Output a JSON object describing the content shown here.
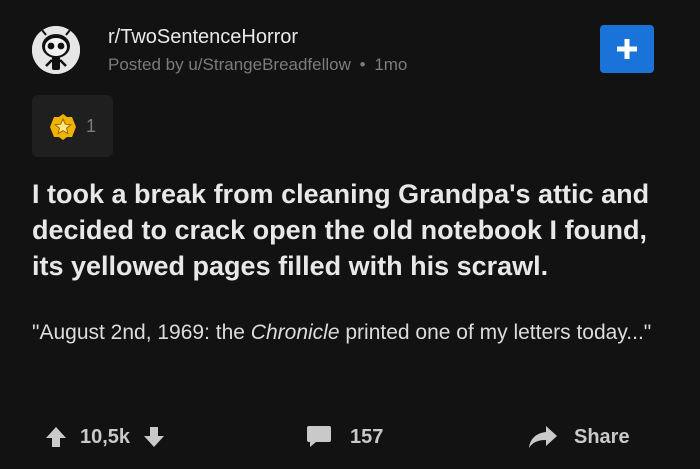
{
  "header": {
    "subreddit": "r/TwoSentenceHorror",
    "posted_by_prefix": "Posted by",
    "username": "u/StrangeBreadfellow",
    "separator": "•",
    "age": "1mo",
    "join_icon": "plus-icon"
  },
  "awards": {
    "icon": "star-award-icon",
    "count": "1"
  },
  "post": {
    "title": "I took a break from cleaning Grandpa's attic and decided to crack open the old notebook I found, its yellowed pages filled with his scrawl.",
    "body_before": "\"August 2nd, 1969: the ",
    "body_italic": "Chronicle",
    "body_after": " printed one of my letters today...\""
  },
  "footer": {
    "score": "10,5k",
    "comments": "157",
    "share_label": "Share"
  },
  "colors": {
    "background": "#121213",
    "join_button": "#1a73d8",
    "award_background": "#1f1f20",
    "muted_text": "#7c7c7c"
  }
}
